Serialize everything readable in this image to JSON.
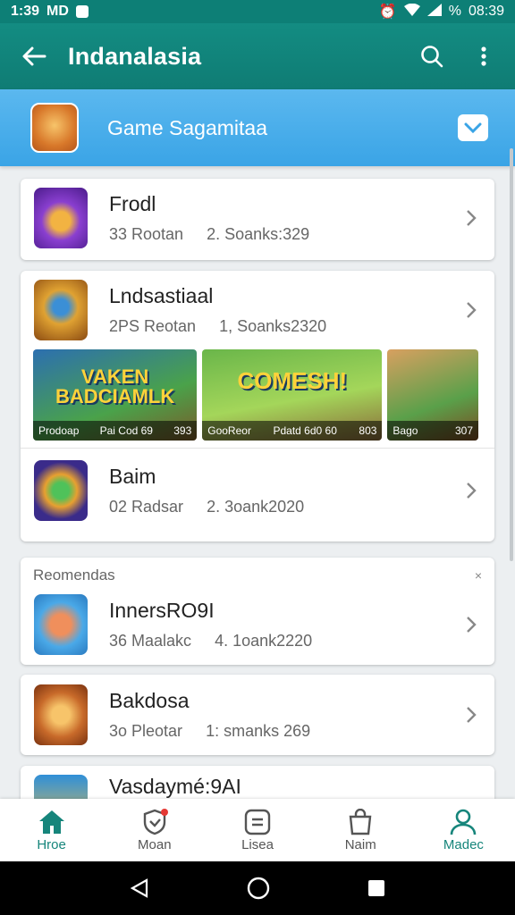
{
  "status_bar": {
    "time": "1:39",
    "carrier": "MD",
    "clock": "08:39",
    "battery": "%"
  },
  "app_bar": {
    "title": "Indanalasia",
    "back_icon": "arrow-left-icon",
    "search_icon": "search-icon",
    "menu_icon": "more-vert-icon"
  },
  "section": {
    "label": "Game Sagamitaa",
    "toggle_icon": "chevron-down-icon"
  },
  "games": [
    {
      "name": "Frodl",
      "meta1": "33 Rootan",
      "meta2": "2. Soanks:329",
      "thumb_colors": [
        "#6b2fb8",
        "#f2b342"
      ]
    },
    {
      "name": "Lndsastiaal",
      "meta1": "2PS Reotan",
      "meta2": "1, Soanks2320",
      "thumb_colors": [
        "#d89a28",
        "#7a3b12"
      ]
    },
    {
      "name": "Baim",
      "meta1": "02 Radsar",
      "meta2": "2. 3oank2020",
      "thumb_colors": [
        "#3a2b8a",
        "#e8a030"
      ]
    }
  ],
  "screenshots": [
    {
      "title": "VAKEN BADCIAMLK",
      "caption_left": "Prodoap",
      "caption_mid": "Pai Cod 69",
      "caption_right": "393"
    },
    {
      "title": "COMESH!",
      "caption_left": "GooReor",
      "caption_mid": "Pdatd 6d0 60",
      "caption_right": "803"
    },
    {
      "title": "",
      "caption_left": "Bago",
      "caption_mid": "",
      "caption_right": "307"
    }
  ],
  "recommendations": {
    "heading": "Reomendas",
    "close": "×",
    "items": [
      {
        "name": "InnersRO9I",
        "meta1": "36 Maalakc",
        "meta2": "4. 1oank2220",
        "thumb_colors": [
          "#4aa9e8",
          "#f08f5c"
        ]
      },
      {
        "name": "Bakdosa",
        "meta1": "3o Pleotar",
        "meta2": "1: smanks 269",
        "thumb_colors": [
          "#c86a2a",
          "#f7c46a"
        ]
      },
      {
        "name": "Vasdaymé:9AI",
        "meta1": "",
        "meta2": "",
        "thumb_colors": [
          "#2f8fd8",
          "#f2c246"
        ]
      }
    ]
  },
  "bottom_nav": [
    {
      "label": "Hroe",
      "icon": "home-icon",
      "active": true
    },
    {
      "label": "Moan",
      "icon": "shield-icon",
      "active": false
    },
    {
      "label": "Lisea",
      "icon": "list-icon",
      "active": false
    },
    {
      "label": "Naim",
      "icon": "bag-icon",
      "active": false
    },
    {
      "label": "Madec",
      "icon": "person-icon",
      "active": true
    }
  ],
  "system_nav": {
    "back": "back-icon",
    "home": "home-circle-icon",
    "recents": "recents-icon"
  }
}
